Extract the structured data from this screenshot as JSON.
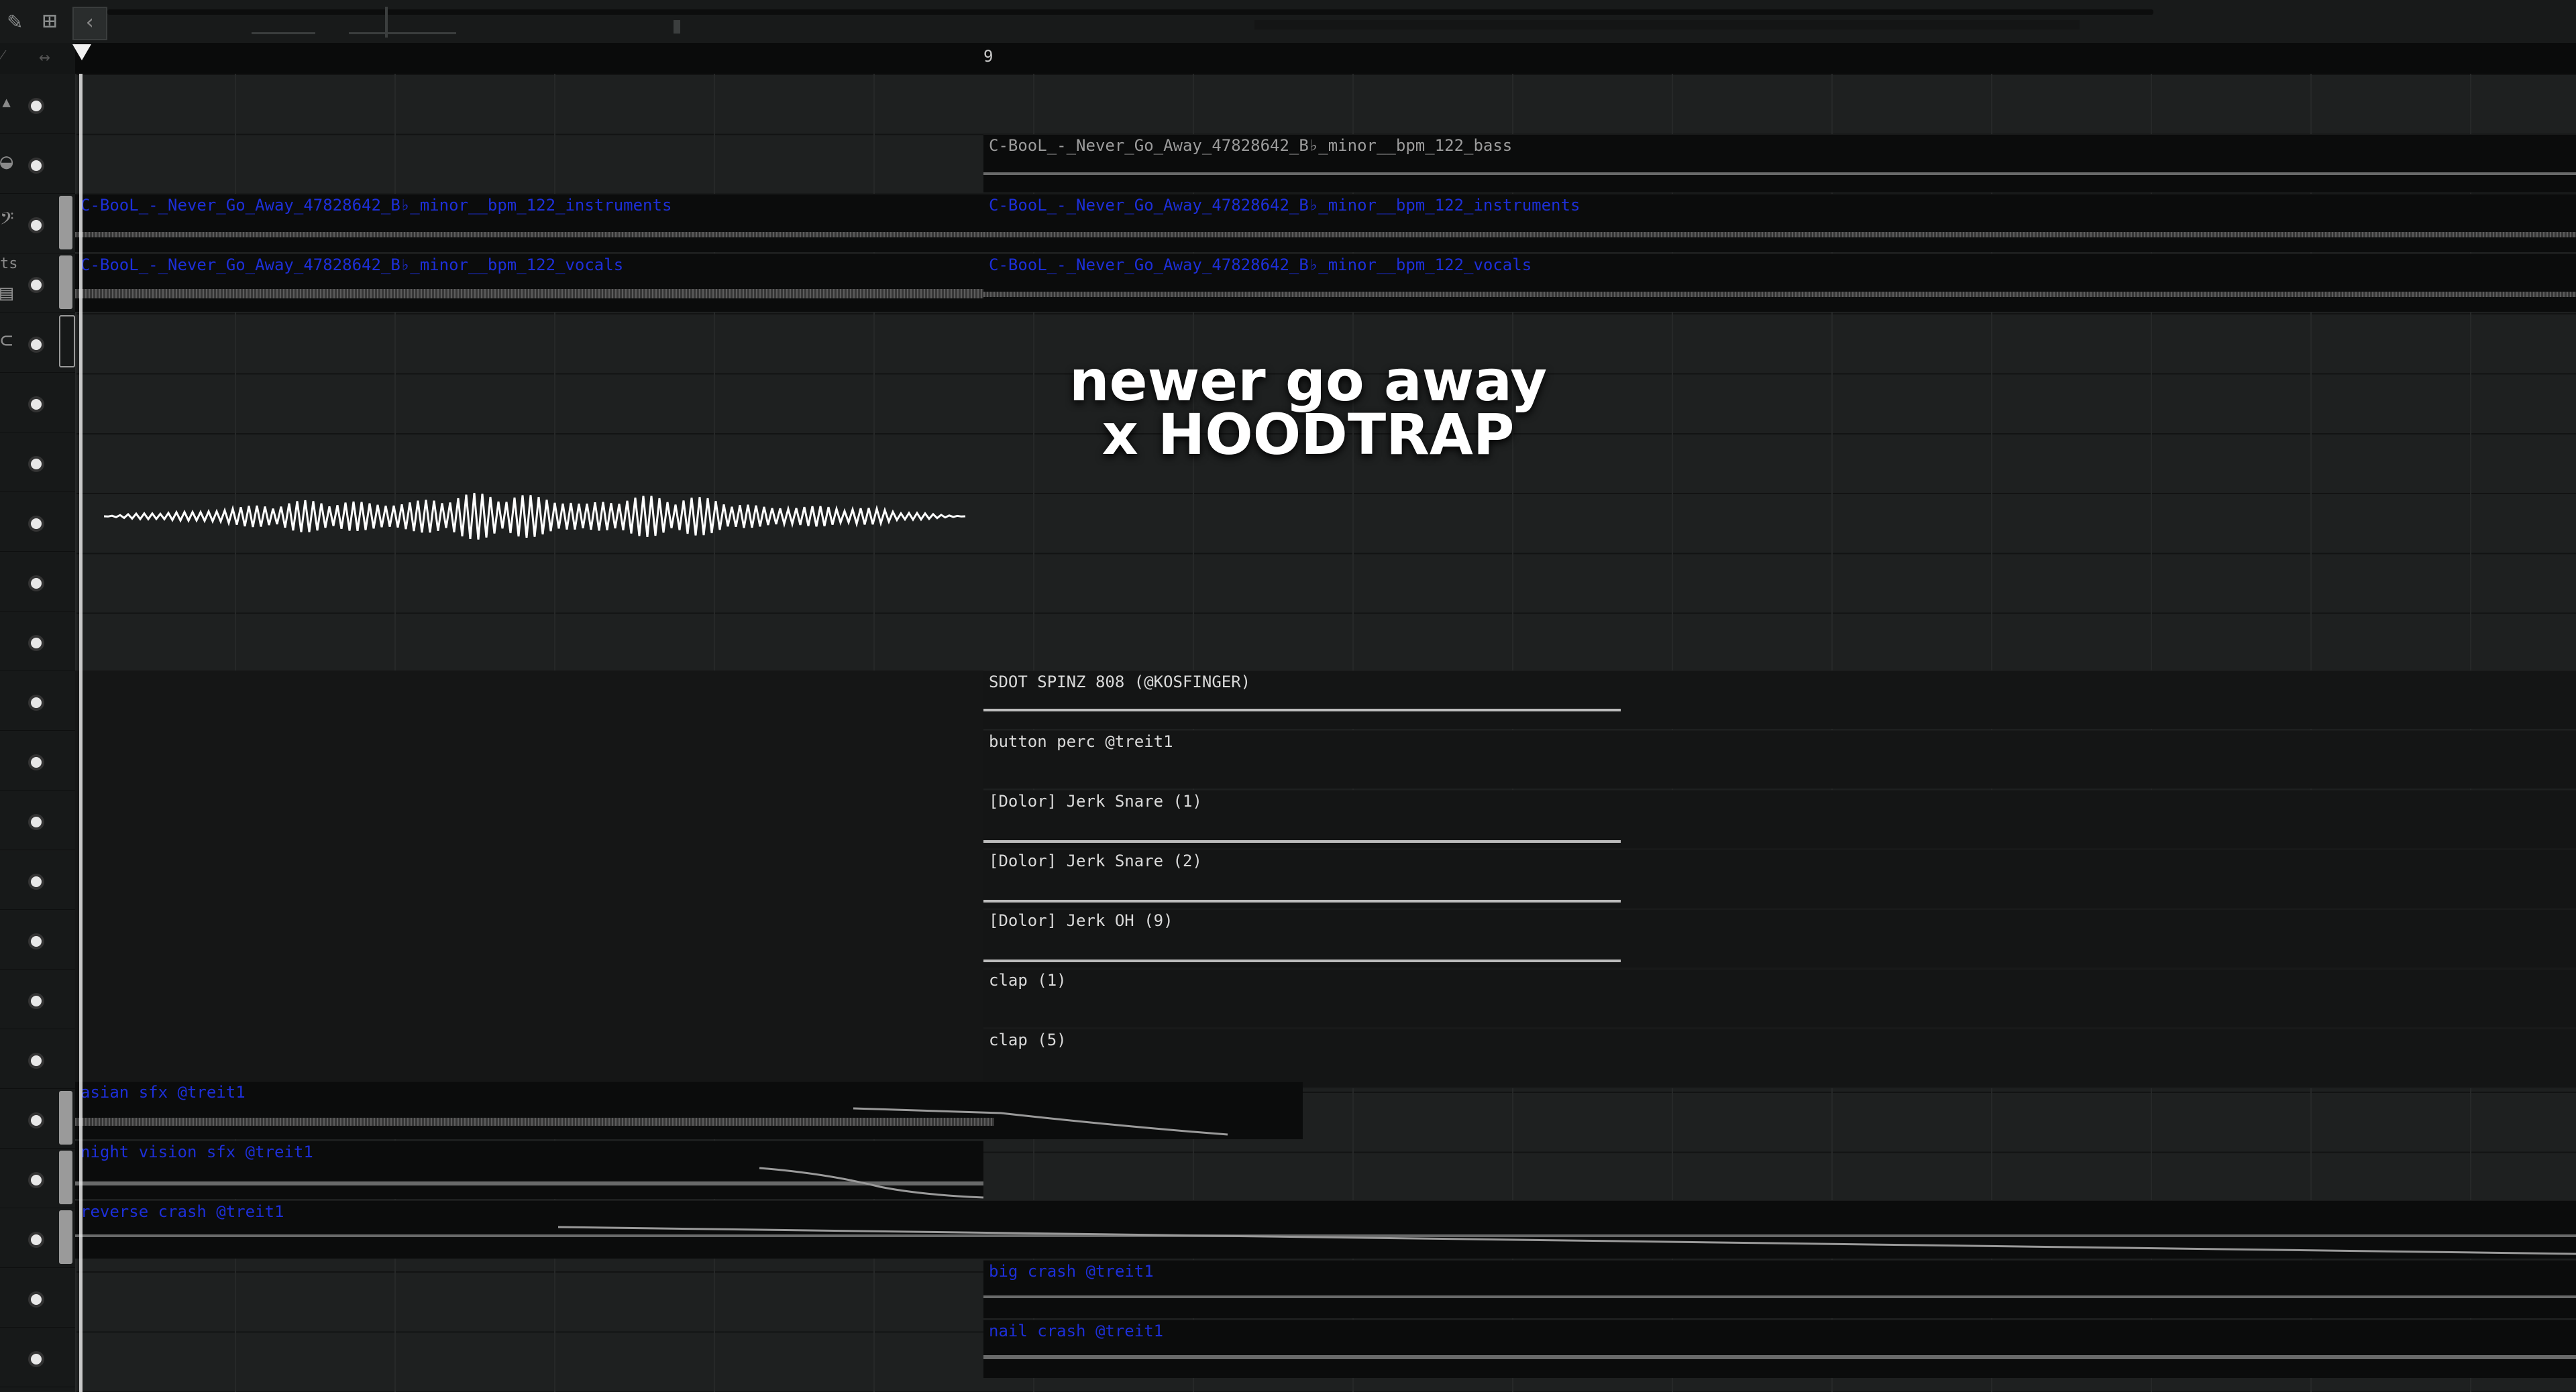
{
  "toolbar": {
    "icons": [
      "pencil-icon",
      "piano-icon",
      "scroll-left-icon"
    ]
  },
  "ruler": {
    "bar_marker": "9"
  },
  "track_headers": {
    "icons": [
      "arrow-up-icon",
      "drum-icon",
      "bass-clef-icon",
      "ts-label",
      "loop-icon"
    ],
    "ts_text": "ts"
  },
  "clips": {
    "bass": "C-BooL_-_Never_Go_Away_47828642_B♭_minor__bpm_122_bass",
    "instruments_a": "C-BooL_-_Never_Go_Away_47828642_B♭_minor__bpm_122_instruments",
    "vocals_a": "C-BooL_-_Never_Go_Away_47828642_B♭_minor__bpm_122_vocals",
    "instruments_b": "C-BooL_-_Never_Go_Away_47828642_B♭_minor__bpm_122_instruments",
    "vocals_b": "C-BooL_-_Never_Go_Away_47828642_B♭_minor__bpm_122_vocals",
    "sdot": "SDOT SPINZ 808 (@KOSFINGER)",
    "button_perc": "button perc @treit1",
    "jerk_snare_1": "[Dolor] Jerk Snare (1)",
    "jerk_snare_2": "[Dolor] Jerk Snare (2)",
    "jerk_oh": "[Dolor] Jerk OH (9)",
    "clap_1": "clap (1)",
    "clap_5": "clap (5)",
    "asian_sfx": "asian sfx @treit1",
    "night_sfx": "night vision sfx @treit1",
    "reverse_crash": "reverse crash @treit1",
    "big_crash": "big crash @treit1",
    "nail_crash": "nail crash @treit1"
  },
  "overlay": {
    "line1": "newer go away",
    "line2": "x HOODTRAP"
  },
  "colors": {
    "background": "#1f2121",
    "clip_bg": "#0b0c0c",
    "audio_label": "#1d2fd8",
    "pattern_label": "#d9d9d9"
  }
}
